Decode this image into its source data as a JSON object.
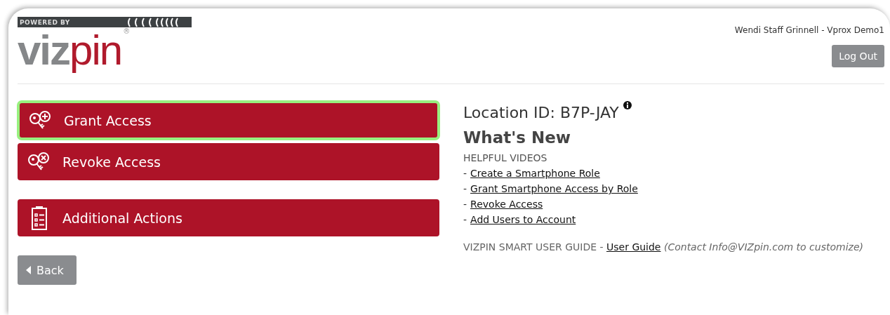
{
  "logo": {
    "tagline": "POWERED BY",
    "brand_gray": "viz",
    "brand_red": "pin",
    "registered": "®"
  },
  "header": {
    "user": "Wendi Staff Grinnell - Vprox Demo1",
    "logout": "Log Out"
  },
  "actions": [
    {
      "label": "Grant Access",
      "kind": "grant",
      "selected": true
    },
    {
      "label": "Revoke Access",
      "kind": "revoke",
      "selected": false
    },
    {
      "label": "Additional Actions",
      "kind": "list",
      "selected": false
    }
  ],
  "back": "Back",
  "location": "Location ID: B7P-JAY",
  "whats_new": "What's New",
  "videos_heading": "HELPFUL VIDEOS",
  "videos": [
    {
      "dash": "-",
      "link": "Create a Smartphone Role"
    },
    {
      "dash": "-",
      "link": "Grant Smartphone Access by Role"
    },
    {
      "dash": "-",
      "link": "Revoke Access"
    },
    {
      "dash": "-",
      "link": "Add Users to Account"
    }
  ],
  "guide": {
    "label": "VIZPIN SMART USER GUIDE -",
    "link": "User Guide",
    "note": "(Contact Info@VIZpin.com to customize)"
  }
}
